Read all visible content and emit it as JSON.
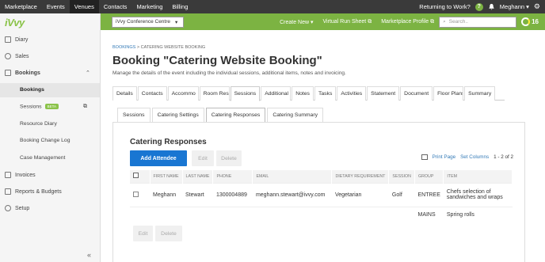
{
  "topbar": {
    "nav": [
      "Marketplace",
      "Events",
      "Venues",
      "Contacts",
      "Marketing",
      "Billing"
    ],
    "active_nav": "Venues",
    "returning": "Returning to Work?",
    "help": "?",
    "user": "Meghann"
  },
  "sidebar": {
    "logo": "iVvy",
    "items": [
      {
        "label": "Diary"
      },
      {
        "label": "Sales"
      },
      {
        "label": "Bookings"
      },
      {
        "label": "Invoices"
      },
      {
        "label": "Reports & Budgets"
      },
      {
        "label": "Setup"
      }
    ],
    "subitems": [
      {
        "label": "Bookings"
      },
      {
        "label": "Sessions",
        "badge": "BETA"
      },
      {
        "label": "Resource Diary"
      },
      {
        "label": "Booking Change Log"
      },
      {
        "label": "Case Management"
      }
    ],
    "collapse": "«"
  },
  "greenbar": {
    "venue": "iVvy Conference Centre",
    "create_new": "Create New",
    "run_sheet": "Virtual Run Sheet",
    "marketplace_profile": "Marketplace Profile",
    "search_placeholder": "Search..",
    "count": "16"
  },
  "page": {
    "breadcrumb_root": "BOOKINGS",
    "breadcrumb_sep": ">",
    "breadcrumb_current": "CATERING WEBSITE BOOKING",
    "title": "Booking \"Catering Website Booking\"",
    "description": "Manage the details of the event including the individual sessions, additional items, notes and invoicing."
  },
  "tabs": [
    "Details",
    "Contacts",
    "Accommo",
    "Room Rese",
    "Sessions",
    "Additional",
    "Notes",
    "Tasks",
    "Activities",
    "Statement",
    "Document",
    "Floor Plans",
    "Summary"
  ],
  "active_tab": "Sessions",
  "subtabs": [
    "Sessions",
    "Catering Settings",
    "Catering Responses",
    "Catering Summary"
  ],
  "active_subtab": "Catering Responses",
  "responses": {
    "title": "Catering Responses",
    "add_label": "Add Attendee",
    "edit_label": "Edit",
    "delete_label": "Delete",
    "print_label": "Print Page",
    "columns_label": "Set Columns",
    "pagination": "1 - 2 of 2",
    "headers": [
      "FIRST NAME",
      "LAST NAME",
      "PHONE",
      "EMAIL",
      "DIETARY REQUIREMENT",
      "SESSION",
      "GROUP",
      "ITEM"
    ],
    "rows": [
      {
        "first": "Meghann",
        "last": "Stewart",
        "phone": "1300004889",
        "email": "meghann.stewart@ivvy.com",
        "dietary": "Vegetarian",
        "session": "Golf",
        "group": "ENTREE",
        "item": "Chefs selection of sandwiches and wraps"
      },
      {
        "first": "",
        "last": "",
        "phone": "",
        "email": "",
        "dietary": "",
        "session": "",
        "group": "MAINS",
        "item": "Spring rolls"
      }
    ]
  },
  "colors": {
    "brand_green": "#7cb342",
    "primary_blue": "#1976d2",
    "topbar": "#3a3a3a"
  }
}
